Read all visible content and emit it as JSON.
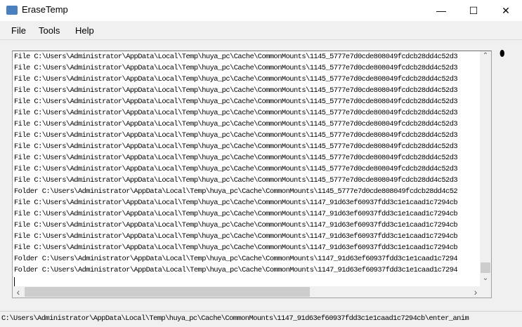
{
  "window": {
    "title": "EraseTemp",
    "minimize": "—",
    "maximize": "☐",
    "close": "✕"
  },
  "menu": [
    "File",
    "Tools",
    "Help"
  ],
  "log_lines": [
    "File C:\\Users\\Administrator\\AppData\\Local\\Temp\\huya_pc\\Cache\\CommonMounts\\1145_5777e7d0cde808049fcdcb28dd4c52d3",
    "File C:\\Users\\Administrator\\AppData\\Local\\Temp\\huya_pc\\Cache\\CommonMounts\\1145_5777e7d0cde808049fcdcb28dd4c52d3",
    "File C:\\Users\\Administrator\\AppData\\Local\\Temp\\huya_pc\\Cache\\CommonMounts\\1145_5777e7d0cde808049fcdcb28dd4c52d3",
    "File C:\\Users\\Administrator\\AppData\\Local\\Temp\\huya_pc\\Cache\\CommonMounts\\1145_5777e7d0cde808049fcdcb28dd4c52d3",
    "File C:\\Users\\Administrator\\AppData\\Local\\Temp\\huya_pc\\Cache\\CommonMounts\\1145_5777e7d0cde808049fcdcb28dd4c52d3",
    "File C:\\Users\\Administrator\\AppData\\Local\\Temp\\huya_pc\\Cache\\CommonMounts\\1145_5777e7d0cde808049fcdcb28dd4c52d3",
    "File C:\\Users\\Administrator\\AppData\\Local\\Temp\\huya_pc\\Cache\\CommonMounts\\1145_5777e7d0cde808049fcdcb28dd4c52d3",
    "File C:\\Users\\Administrator\\AppData\\Local\\Temp\\huya_pc\\Cache\\CommonMounts\\1145_5777e7d0cde808049fcdcb28dd4c52d3",
    "File C:\\Users\\Administrator\\AppData\\Local\\Temp\\huya_pc\\Cache\\CommonMounts\\1145_5777e7d0cde808049fcdcb28dd4c52d3",
    "File C:\\Users\\Administrator\\AppData\\Local\\Temp\\huya_pc\\Cache\\CommonMounts\\1145_5777e7d0cde808049fcdcb28dd4c52d3",
    "File C:\\Users\\Administrator\\AppData\\Local\\Temp\\huya_pc\\Cache\\CommonMounts\\1145_5777e7d0cde808049fcdcb28dd4c52d3",
    "File C:\\Users\\Administrator\\AppData\\Local\\Temp\\huya_pc\\Cache\\CommonMounts\\1145_5777e7d0cde808049fcdcb28dd4c52d3",
    "Folder C:\\Users\\Administrator\\AppData\\Local\\Temp\\huya_pc\\Cache\\CommonMounts\\1145_5777e7d0cde808049fcdcb28dd4c52",
    "File C:\\Users\\Administrator\\AppData\\Local\\Temp\\huya_pc\\Cache\\CommonMounts\\1147_91d63ef60937fdd3c1e1caad1c7294cb",
    "File C:\\Users\\Administrator\\AppData\\Local\\Temp\\huya_pc\\Cache\\CommonMounts\\1147_91d63ef60937fdd3c1e1caad1c7294cb",
    "File C:\\Users\\Administrator\\AppData\\Local\\Temp\\huya_pc\\Cache\\CommonMounts\\1147_91d63ef60937fdd3c1e1caad1c7294cb",
    "File C:\\Users\\Administrator\\AppData\\Local\\Temp\\huya_pc\\Cache\\CommonMounts\\1147_91d63ef60937fdd3c1e1caad1c7294cb",
    "File C:\\Users\\Administrator\\AppData\\Local\\Temp\\huya_pc\\Cache\\CommonMounts\\1147_91d63ef60937fdd3c1e1caad1c7294cb",
    "Folder C:\\Users\\Administrator\\AppData\\Local\\Temp\\huya_pc\\Cache\\CommonMounts\\1147_91d63ef60937fdd3c1e1caad1c7294",
    "Folder C:\\Users\\Administrator\\AppData\\Local\\Temp\\huya_pc\\Cache\\CommonMounts\\1147_91d63ef60937fdd3c1e1caad1c7294"
  ],
  "status": "C:\\Users\\Administrator\\AppData\\Local\\Temp\\huya_pc\\Cache\\CommonMounts\\1147_91d63ef60937fdd3c1e1caad1c7294cb\\enter_anim",
  "icons": {
    "up": "⌃",
    "down": "⌄",
    "left": "‹",
    "right": "›",
    "side": "⬮"
  }
}
